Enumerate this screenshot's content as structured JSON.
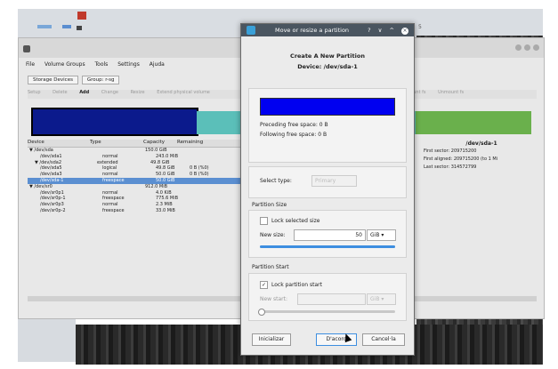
{
  "background": {
    "top_text": "",
    "right_text": "5"
  },
  "main_window": {
    "menu": [
      "File",
      "Volume Groups",
      "Tools",
      "Settings",
      "Ajuda"
    ],
    "tabs": [
      "Storage Devices",
      "Group: r-sg"
    ],
    "toolbar": [
      "Setup",
      "Delete",
      "Add",
      "Change",
      "Resize",
      "Extend physical volume",
      "",
      "Unmount fs",
      "Unmount fs"
    ],
    "table_headers": [
      "Device",
      "Type",
      "Capacity",
      "Remaining"
    ],
    "table_rows": [
      {
        "device": "▼ /dev/sda",
        "type": "",
        "capacity": "150.0 GiB",
        "remaining": ""
      },
      {
        "device": "/dev/sda1",
        "type": "normal",
        "capacity": "243.0 MiB",
        "remaining": ""
      },
      {
        "device": "▼ /dev/sda2",
        "type": "extended",
        "capacity": "49.8 GiB",
        "remaining": ""
      },
      {
        "device": "/dev/sda5",
        "type": "logical",
        "capacity": "49.8 GiB",
        "remaining": "0 B (%0)"
      },
      {
        "device": "/dev/sda3",
        "type": "normal",
        "capacity": "50.0 GiB",
        "remaining": "0 B (%0)"
      },
      {
        "device": "/dev/sda-1",
        "type": "freespace",
        "capacity": "50.0 GiB",
        "remaining": "",
        "selected": true
      },
      {
        "device": "▼ /dev/sr0",
        "type": "",
        "capacity": "912.0 MiB",
        "remaining": ""
      },
      {
        "device": "/dev/sr0p1",
        "type": "normal",
        "capacity": "4.0 KiB",
        "remaining": ""
      },
      {
        "device": "/dev/sr0p-1",
        "type": "freespace",
        "capacity": "775.6 MiB",
        "remaining": ""
      },
      {
        "device": "/dev/sr0p3",
        "type": "normal",
        "capacity": "2.3 MiB",
        "remaining": ""
      },
      {
        "device": "/dev/sr0p-2",
        "type": "freespace",
        "capacity": "33.0 MiB",
        "remaining": ""
      }
    ],
    "info": {
      "title": "/dev/sda-1",
      "lines": [
        "First sector: 209715200",
        "First aligned: 209715200 (to 1 Mi",
        "Last sector: 314572799"
      ]
    }
  },
  "dialog": {
    "title": "Move or resize a partition",
    "title_buttons": "? ∨ ^",
    "close": "×",
    "heading": "Create A New Partition",
    "device": "Device: /dev/sda-1",
    "preceding": "Preceding free space: 0 B",
    "following": "Following free space: 0 B",
    "bar_color": "#0000f0",
    "select_type_label": "Select type:",
    "select_type_value": "Primary",
    "partition_size_label": "Partition Size",
    "lock_size_label": "Lock selected size",
    "lock_size_checked": false,
    "new_size_label": "New size:",
    "new_size_value": "50",
    "size_unit": "GiB",
    "size_fraction": 1.0,
    "partition_start_label": "Partition Start",
    "lock_start_label": "Lock partition start",
    "lock_start_checked": true,
    "new_start_label": "New start:",
    "new_start_unit": "GiB",
    "buttons": {
      "reset": "Inicializar",
      "ok": "D'acord",
      "cancel": "Cancel·la"
    }
  }
}
